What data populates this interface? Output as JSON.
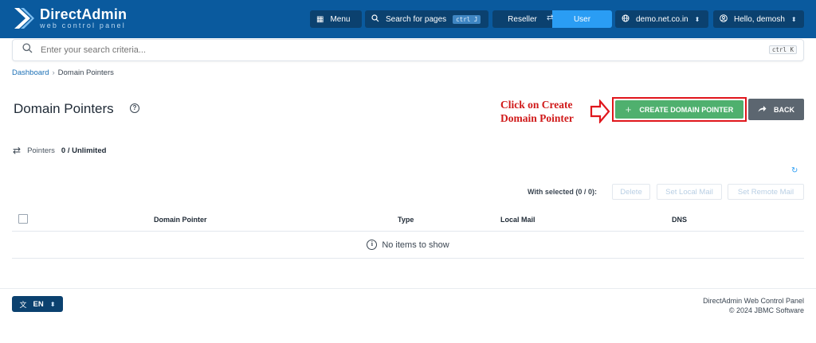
{
  "header": {
    "logo_title": "DirectAdmin",
    "logo_subtitle": "web control panel",
    "menu_label": "Menu",
    "search_pages_label": "Search for pages",
    "search_pages_shortcut": "ctrl J",
    "role_reseller": "Reseller",
    "role_user": "User",
    "domain_select": "demo.net.co.in",
    "user_greeting": "Hello, demosh"
  },
  "search": {
    "placeholder": "Enter your search criteria...",
    "shortcut": "ctrl K"
  },
  "breadcrumb": {
    "root": "Dashboard",
    "current": "Domain Pointers"
  },
  "page": {
    "title": "Domain Pointers",
    "annotation_line1": "Click on Create",
    "annotation_line2": "Domain Pointer",
    "create_button": "CREATE DOMAIN POINTER",
    "back_button": "BACK",
    "pointers_label": "Pointers",
    "pointers_value": "0 / Unlimited"
  },
  "actions": {
    "with_selected": "With selected (0 / 0):",
    "delete": "Delete",
    "set_local_mail": "Set Local Mail",
    "set_remote_mail": "Set Remote Mail"
  },
  "table": {
    "columns": [
      "Domain Pointer",
      "Type",
      "Local Mail",
      "DNS"
    ],
    "empty_message": "No items to show"
  },
  "footer": {
    "language": "EN",
    "product": "DirectAdmin Web Control Panel",
    "copyright": "© 2024 JBMC Software"
  },
  "colors": {
    "header_bg": "#0a5a9e",
    "create_green": "#4fb06e",
    "annotation_red": "#d01a1a",
    "user_toggle": "#2a9df4"
  }
}
